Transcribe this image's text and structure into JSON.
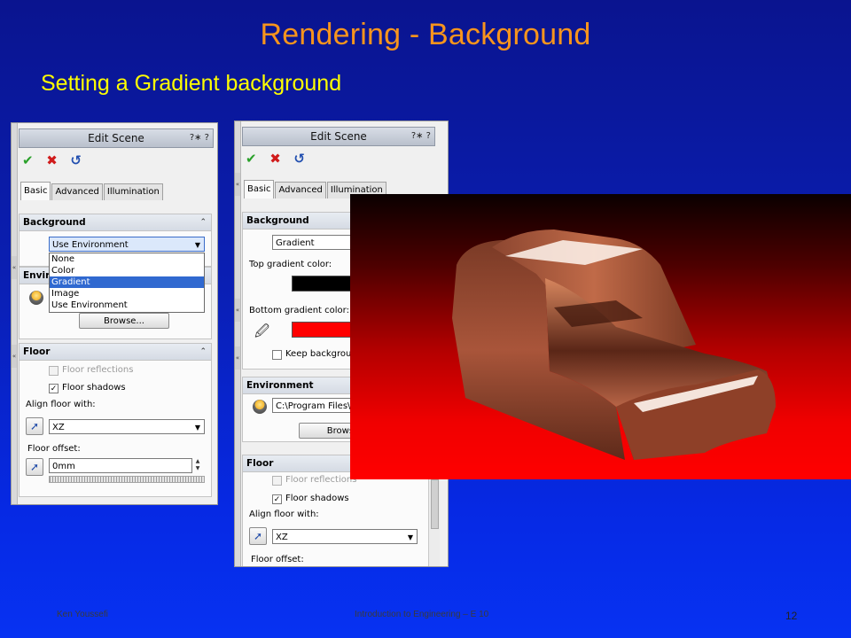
{
  "slide": {
    "title": "Rendering - Background",
    "subtitle": "Setting a Gradient background",
    "footer_left": "Ken Youssefi",
    "footer_center": "Introduction to Engineering – E 10",
    "page_number": "12"
  },
  "left_panel": {
    "title": "Edit Scene",
    "help": "?∗ ?",
    "tabs": [
      "Basic",
      "Advanced",
      "Illumination"
    ],
    "background_header": "Background",
    "background_value": "Use Environment",
    "dropdown_options": [
      "None",
      "Color",
      "Gradient",
      "Image",
      "Use Environment"
    ],
    "dropdown_selected": "Gradient",
    "environment_header_partial": "Envir",
    "browse_label": "Browse...",
    "floor_header": "Floor",
    "floor_reflections": "Floor reflections",
    "floor_shadows": "Floor shadows",
    "align_floor_label": "Align floor with:",
    "align_value": "XZ",
    "floor_offset_label": "Floor offset:",
    "floor_offset_value": "0mm"
  },
  "right_panel": {
    "title": "Edit Scene",
    "help": "?∗ ?",
    "tabs": [
      "Basic",
      "Advanced",
      "Illumination"
    ],
    "background_header": "Background",
    "background_value": "Gradient",
    "top_color_label": "Top gradient color:",
    "top_color": "#000000",
    "bottom_color_label": "Bottom gradient color:",
    "bottom_color": "#ff0000",
    "keep_background_label": "Keep backgroun",
    "environment_header": "Environment",
    "environment_path": "C:\\Program Files\\",
    "browse_label_partial": "Browse",
    "floor_header": "Floor",
    "floor_reflections": "Floor reflections",
    "floor_shadows": "Floor shadows",
    "align_floor_label": "Align floor with:",
    "align_value": "XZ",
    "floor_offset_label": "Floor offset:"
  },
  "colors": {
    "title": "#f7941d",
    "subtitle": "#ffff00",
    "accent_selection": "#3069d0",
    "model_copper": "#9b4a30"
  }
}
